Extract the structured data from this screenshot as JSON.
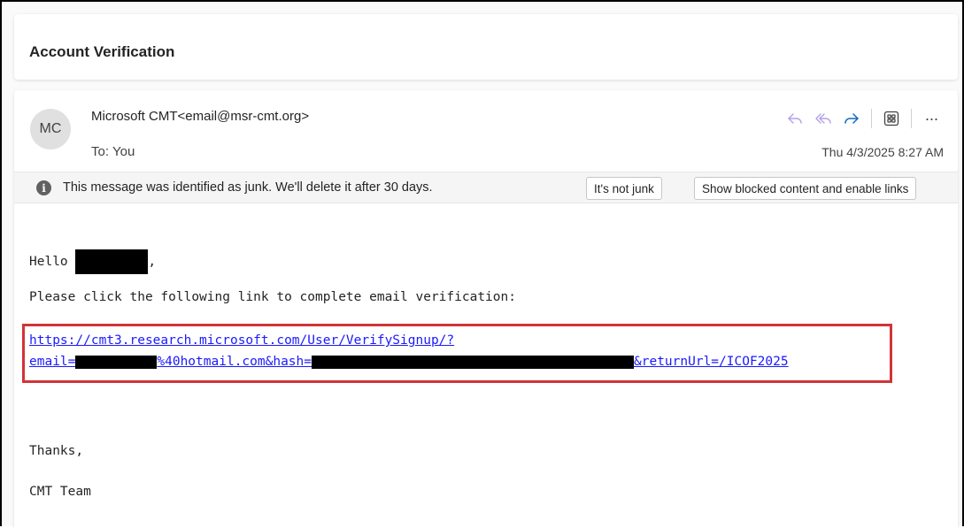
{
  "subject": "Account Verification",
  "sender": {
    "initials": "MC",
    "display": "Microsoft CMT<email@msr-cmt.org>"
  },
  "recipient": {
    "label": "To:",
    "value": "You"
  },
  "date": "Thu 4/3/2025 8:27 AM",
  "actions": {
    "reply_icon": "reply-icon",
    "reply_all_icon": "reply-all-icon",
    "forward_icon": "forward-icon",
    "apps_icon": "apps-icon",
    "more": "···"
  },
  "junk_bar": {
    "info_glyph": "i",
    "message": "This message was identified as junk. We'll delete it after 30 days.",
    "not_junk_label": "It's not junk",
    "show_blocked_label": "Show blocked content and enable links"
  },
  "body": {
    "greeting": "Hello",
    "greeting_end": ",",
    "instruction": "Please click the following link to complete email verification:",
    "link_line1": "https://cmt3.research.microsoft.com/User/VerifySignup/?",
    "link_line2_a": "email=",
    "link_line2_b": "%40hotmail.com&hash=",
    "link_line2_c": "&returnUrl=/ICOF2025",
    "thanks": "Thanks,",
    "signature": "CMT Team"
  },
  "colors": {
    "accent": "#0f6cbd",
    "link": "#1a1aff",
    "highlight_box": "#d13438"
  }
}
